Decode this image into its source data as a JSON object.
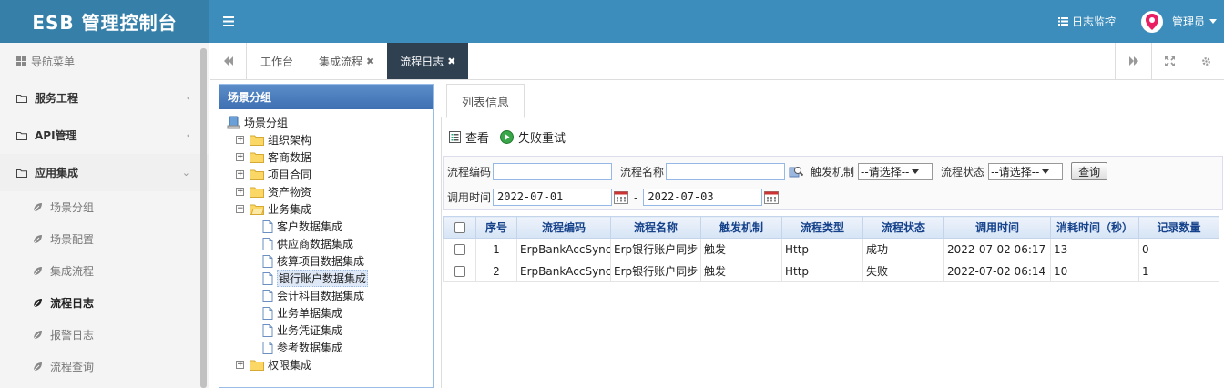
{
  "header": {
    "brand": "ESB 管理控制台",
    "log_monitor": "日志监控",
    "user": "管理员",
    "colors": {
      "topbar": "#3c8dbc",
      "brand_bg": "#367fa9",
      "avatar_pin": "#e91e63"
    }
  },
  "sidebar": {
    "title": "导航菜单",
    "sections": [
      {
        "label": "服务工程",
        "arrow": "‹"
      },
      {
        "label": "API管理",
        "arrow": "‹"
      },
      {
        "label": "应用集成",
        "arrow": "⌄"
      }
    ],
    "sub_items": [
      {
        "label": "场景分组"
      },
      {
        "label": "场景配置"
      },
      {
        "label": "集成流程"
      },
      {
        "label": "流程日志"
      },
      {
        "label": "报警日志"
      },
      {
        "label": "流程查询"
      }
    ]
  },
  "tabs": [
    {
      "label": "工作台"
    },
    {
      "label": "集成流程"
    },
    {
      "label": "流程日志"
    }
  ],
  "tree_panel": {
    "title": "场景分组",
    "root": "场景分组",
    "folders": [
      "组织架构",
      "客商数据",
      "项目合同",
      "资产物资",
      "业务集成",
      "权限集成"
    ],
    "children": [
      "客户数据集成",
      "供应商数据集成",
      "核算项目数据集成",
      "银行账户数据集成",
      "会计科目数据集成",
      "业务单据集成",
      "业务凭证集成",
      "参考数据集成"
    ]
  },
  "list_panel": {
    "tab": "列表信息",
    "toolbar": {
      "view": "查看",
      "retry": "失败重试"
    },
    "query": {
      "code_label": "流程编码",
      "code_value": "",
      "name_label": "流程名称",
      "name_value": "",
      "trigger_label": "触发机制",
      "trigger_value": "--请选择--",
      "status_label": "流程状态",
      "status_value": "--请选择--",
      "query_btn": "查询",
      "time_label": "调用时间",
      "start": "2022-07-01",
      "dash": "-",
      "end": "2022-07-03"
    },
    "columns": [
      "序号",
      "流程编码",
      "流程名称",
      "触发机制",
      "流程类型",
      "流程状态",
      "调用时间",
      "消耗时间（秒）",
      "记录数量"
    ],
    "rows": [
      {
        "no": "1",
        "code": "ErpBankAccSync",
        "name": "Erp银行账户同步",
        "trigger": "触发",
        "type": "Http",
        "status": "成功",
        "time": "2022-07-02 06:17",
        "cost": "13",
        "count": "0"
      },
      {
        "no": "2",
        "code": "ErpBankAccSync",
        "name": "Erp银行账户同步",
        "trigger": "触发",
        "type": "Http",
        "status": "失败",
        "time": "2022-07-02 06:14",
        "cost": "10",
        "count": "1"
      }
    ]
  }
}
